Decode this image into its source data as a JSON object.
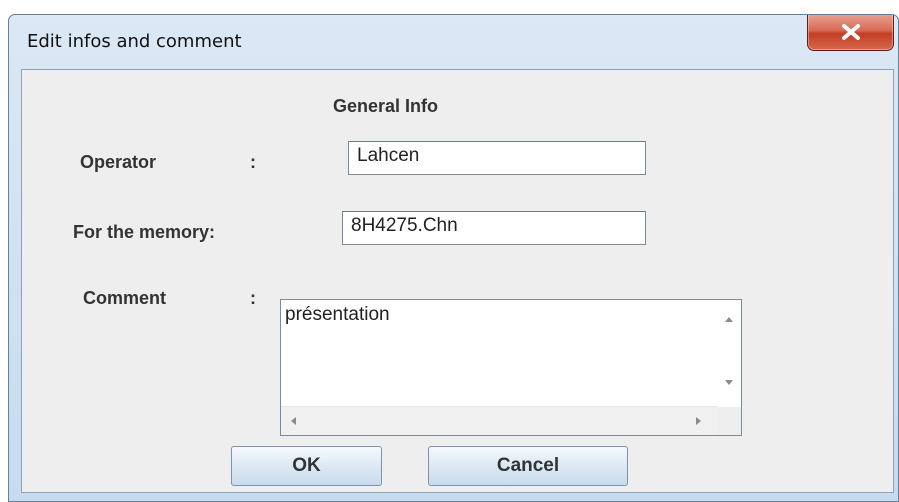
{
  "window": {
    "title": "Edit infos and comment",
    "close_label": "X"
  },
  "form": {
    "section_title": "General Info",
    "operator_label": "Operator",
    "operator_colon": ":",
    "operator_value": "Lahcen",
    "memory_label": "For the memory:",
    "memory_value": "8H4275.Chn",
    "comment_label": "Comment",
    "comment_colon": ":",
    "comment_value": "présentation"
  },
  "buttons": {
    "ok_label": "OK",
    "cancel_label": "Cancel"
  },
  "icons": [
    "close-icon",
    "scroll-up-icon",
    "scroll-down-icon",
    "scroll-left-icon",
    "scroll-right-icon"
  ]
}
